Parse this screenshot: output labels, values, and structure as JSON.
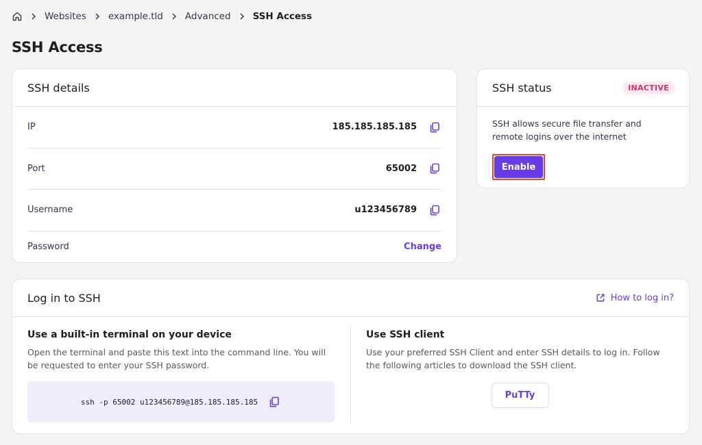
{
  "breadcrumb": {
    "items": [
      "Websites",
      "example.tld",
      "Advanced"
    ],
    "current": "SSH Access"
  },
  "page": {
    "title": "SSH Access"
  },
  "details": {
    "title": "SSH details",
    "rows": [
      {
        "label": "IP",
        "value": "185.185.185.185"
      },
      {
        "label": "Port",
        "value": "65002"
      },
      {
        "label": "Username",
        "value": "u123456789"
      },
      {
        "label": "Password",
        "action": "Change"
      }
    ]
  },
  "status": {
    "title": "SSH status",
    "badge": "INACTIVE",
    "description": "SSH allows secure file transfer and remote logins over the internet",
    "button": "Enable"
  },
  "login": {
    "title": "Log in to SSH",
    "help_link": "How to log in?",
    "terminal": {
      "heading": "Use a built-in terminal on your device",
      "description": "Open the terminal and paste this text into the command line. You will be requested to enter your SSH password.",
      "command": "ssh -p 65002 u123456789@185.185.185.185"
    },
    "client": {
      "heading": "Use SSH client",
      "description": "Use your preferred SSH Client and enter SSH details to log in. Follow the following articles to download the SSH client.",
      "button": "PuTTy"
    }
  },
  "colors": {
    "accent": "#673de6",
    "badge_bg": "#ffe8ef",
    "badge_text": "#d63163",
    "terminal_bg": "#efedfc"
  },
  "icons": {
    "home": "home-icon",
    "separator": "chevron-right-icon",
    "copy": "copy-icon",
    "external": "external-link-icon"
  }
}
